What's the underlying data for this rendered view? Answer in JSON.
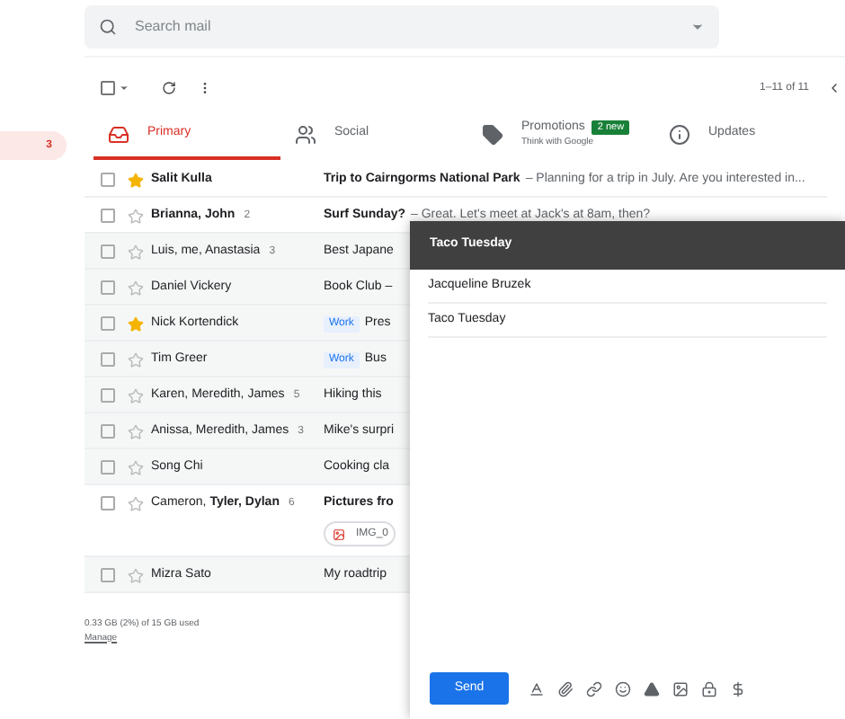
{
  "search": {
    "placeholder": "Search mail"
  },
  "sidebar": {
    "badge": "3"
  },
  "toolbar": {
    "select_all_checked": false,
    "range": "1–11 of 11"
  },
  "tabs": [
    {
      "label": "Primary",
      "selected": true
    },
    {
      "label": "Social",
      "selected": false
    },
    {
      "label": "Promotions",
      "selected": false,
      "badge": "2 new",
      "subtitle": "Think with Google"
    },
    {
      "label": "Updates",
      "selected": false
    }
  ],
  "rows": [
    {
      "sender": "Salit Kulla",
      "subject": "Trip to Cairngorms National Park",
      "snippet": "– Planning for a trip in July. Are you interested in...",
      "unread": true,
      "starred": true,
      "checked": false
    },
    {
      "sender": "Brianna, John",
      "count": "2",
      "subject": "Surf Sunday?",
      "snippet": "– Great. Let's meet at Jack's at 8am, then?",
      "unread": true,
      "starred": false,
      "checked": false
    },
    {
      "sender": "Luis, me, Anastasia",
      "count": "3",
      "subject": "Best Japane",
      "unread": false,
      "starred": false,
      "checked": false
    },
    {
      "sender": "Daniel Vickery",
      "subject": "Book Club –",
      "unread": false,
      "starred": false,
      "checked": false
    },
    {
      "sender": "Nick Kortendick",
      "label": "Work",
      "subject": "Pres",
      "unread": false,
      "starred": true,
      "checked": false
    },
    {
      "sender": "Tim Greer",
      "label": "Work",
      "subject": "Bus",
      "unread": false,
      "starred": false,
      "checked": false
    },
    {
      "sender": "Karen, Meredith, James",
      "count": "5",
      "subject": "Hiking this",
      "unread": false,
      "starred": false,
      "checked": false
    },
    {
      "sender": "Anissa, Meredith, James",
      "count": "3",
      "subject": "Mike's surpri",
      "unread": false,
      "starred": false,
      "checked": false
    },
    {
      "sender": "Song Chi",
      "subject": "Cooking cla",
      "unread": false,
      "starred": false,
      "checked": false
    },
    {
      "sender": "Cameron, **Tyler, Dylan**",
      "count": "6",
      "subject": "Pictures fro",
      "attachment": "IMG_0",
      "unread": true,
      "starred": false,
      "checked": false
    },
    {
      "sender": "Mizra Sato",
      "subject": "My roadtrip",
      "unread": false,
      "starred": false,
      "checked": false
    }
  ],
  "footer": {
    "storage": "0.33 GB (2%) of 15 GB used",
    "link": "Manage"
  },
  "compose": {
    "title": "Taco Tuesday",
    "to": "Jacqueline Bruzek",
    "subject": "Taco Tuesday",
    "send": "Send"
  }
}
